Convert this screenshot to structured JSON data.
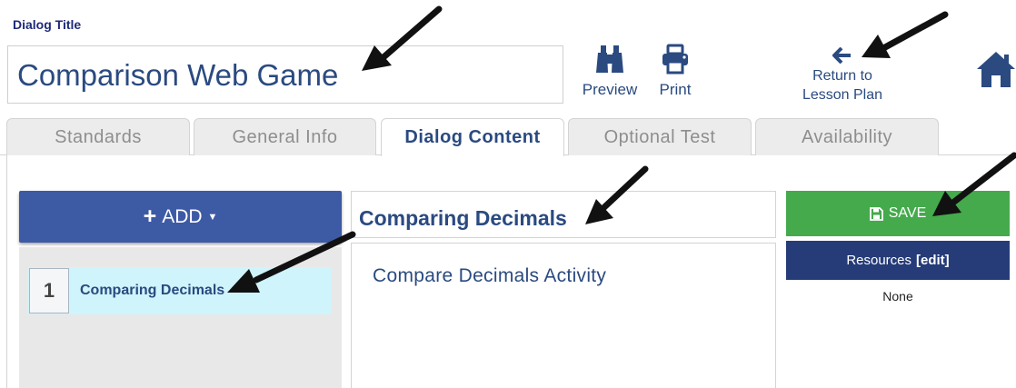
{
  "header": {
    "dialog_label": "Dialog Title",
    "title_value": "Comparison Web Game",
    "preview_label": "Preview",
    "print_label": "Print",
    "return_line1": "Return to",
    "return_line2": "Lesson Plan"
  },
  "tabs": [
    {
      "label": "Standards",
      "active": false
    },
    {
      "label": "General Info",
      "active": false
    },
    {
      "label": "Dialog Content",
      "active": true
    },
    {
      "label": "Optional Test",
      "active": false
    },
    {
      "label": "Availability",
      "active": false
    }
  ],
  "left_panel": {
    "add_label": "ADD",
    "items": [
      {
        "number": "1",
        "label": "Comparing Decimals"
      }
    ]
  },
  "middle_panel": {
    "title": "Comparing Decimals",
    "activity": "Compare Decimals Activity"
  },
  "right_panel": {
    "save_label": "SAVE",
    "resources_label": "Resources",
    "resources_edit": "[edit]",
    "resources_value": "None"
  },
  "colors": {
    "accent_blue": "#3d5aa5",
    "dark_navy": "#253c78",
    "save_green": "#44aa4c",
    "selected_row": "#cff4fb",
    "text_blue": "#2a4a80"
  },
  "icons": [
    "binoculars-icon",
    "printer-icon",
    "arrow-left-icon",
    "home-icon",
    "plus-icon",
    "caret-down-icon",
    "floppy-disk-icon"
  ]
}
